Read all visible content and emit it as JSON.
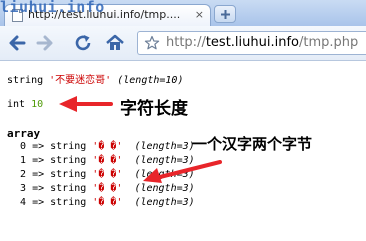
{
  "browser": {
    "watermark": "liuhui.info",
    "tab_title": "http://test.liuhui.info/tmp....",
    "tab_close": "×",
    "url_scheme": "http://",
    "url_host": "test.liuhui.info",
    "url_path": "/tmp.php"
  },
  "dump": {
    "line1": {
      "type": "string",
      "value": "'不要迷恋哥'",
      "meta": "(length=10)"
    },
    "line2": {
      "type": "int",
      "value": "10"
    },
    "array_label": "array",
    "rows": [
      {
        "key": "0",
        "arrow": "=>",
        "type": "string",
        "value": "'� �'",
        "meta": "(length=3)"
      },
      {
        "key": "1",
        "arrow": "=>",
        "type": "string",
        "value": "'� �'",
        "meta": "(length=3)"
      },
      {
        "key": "2",
        "arrow": "=>",
        "type": "string",
        "value": "'� �'",
        "meta": "(length=3)"
      },
      {
        "key": "3",
        "arrow": "=>",
        "type": "string",
        "value": "'� �'",
        "meta": "(length=3)"
      },
      {
        "key": "4",
        "arrow": "=>",
        "type": "string",
        "value": "'� �'",
        "meta": "(length=3)"
      }
    ]
  },
  "annotations": {
    "length_label": "字符长度",
    "bytes_label": "一个汉字两个字节"
  },
  "colors": {
    "arrow": "#e8252a",
    "string": "#cc0000",
    "int": "#4e9a06"
  }
}
